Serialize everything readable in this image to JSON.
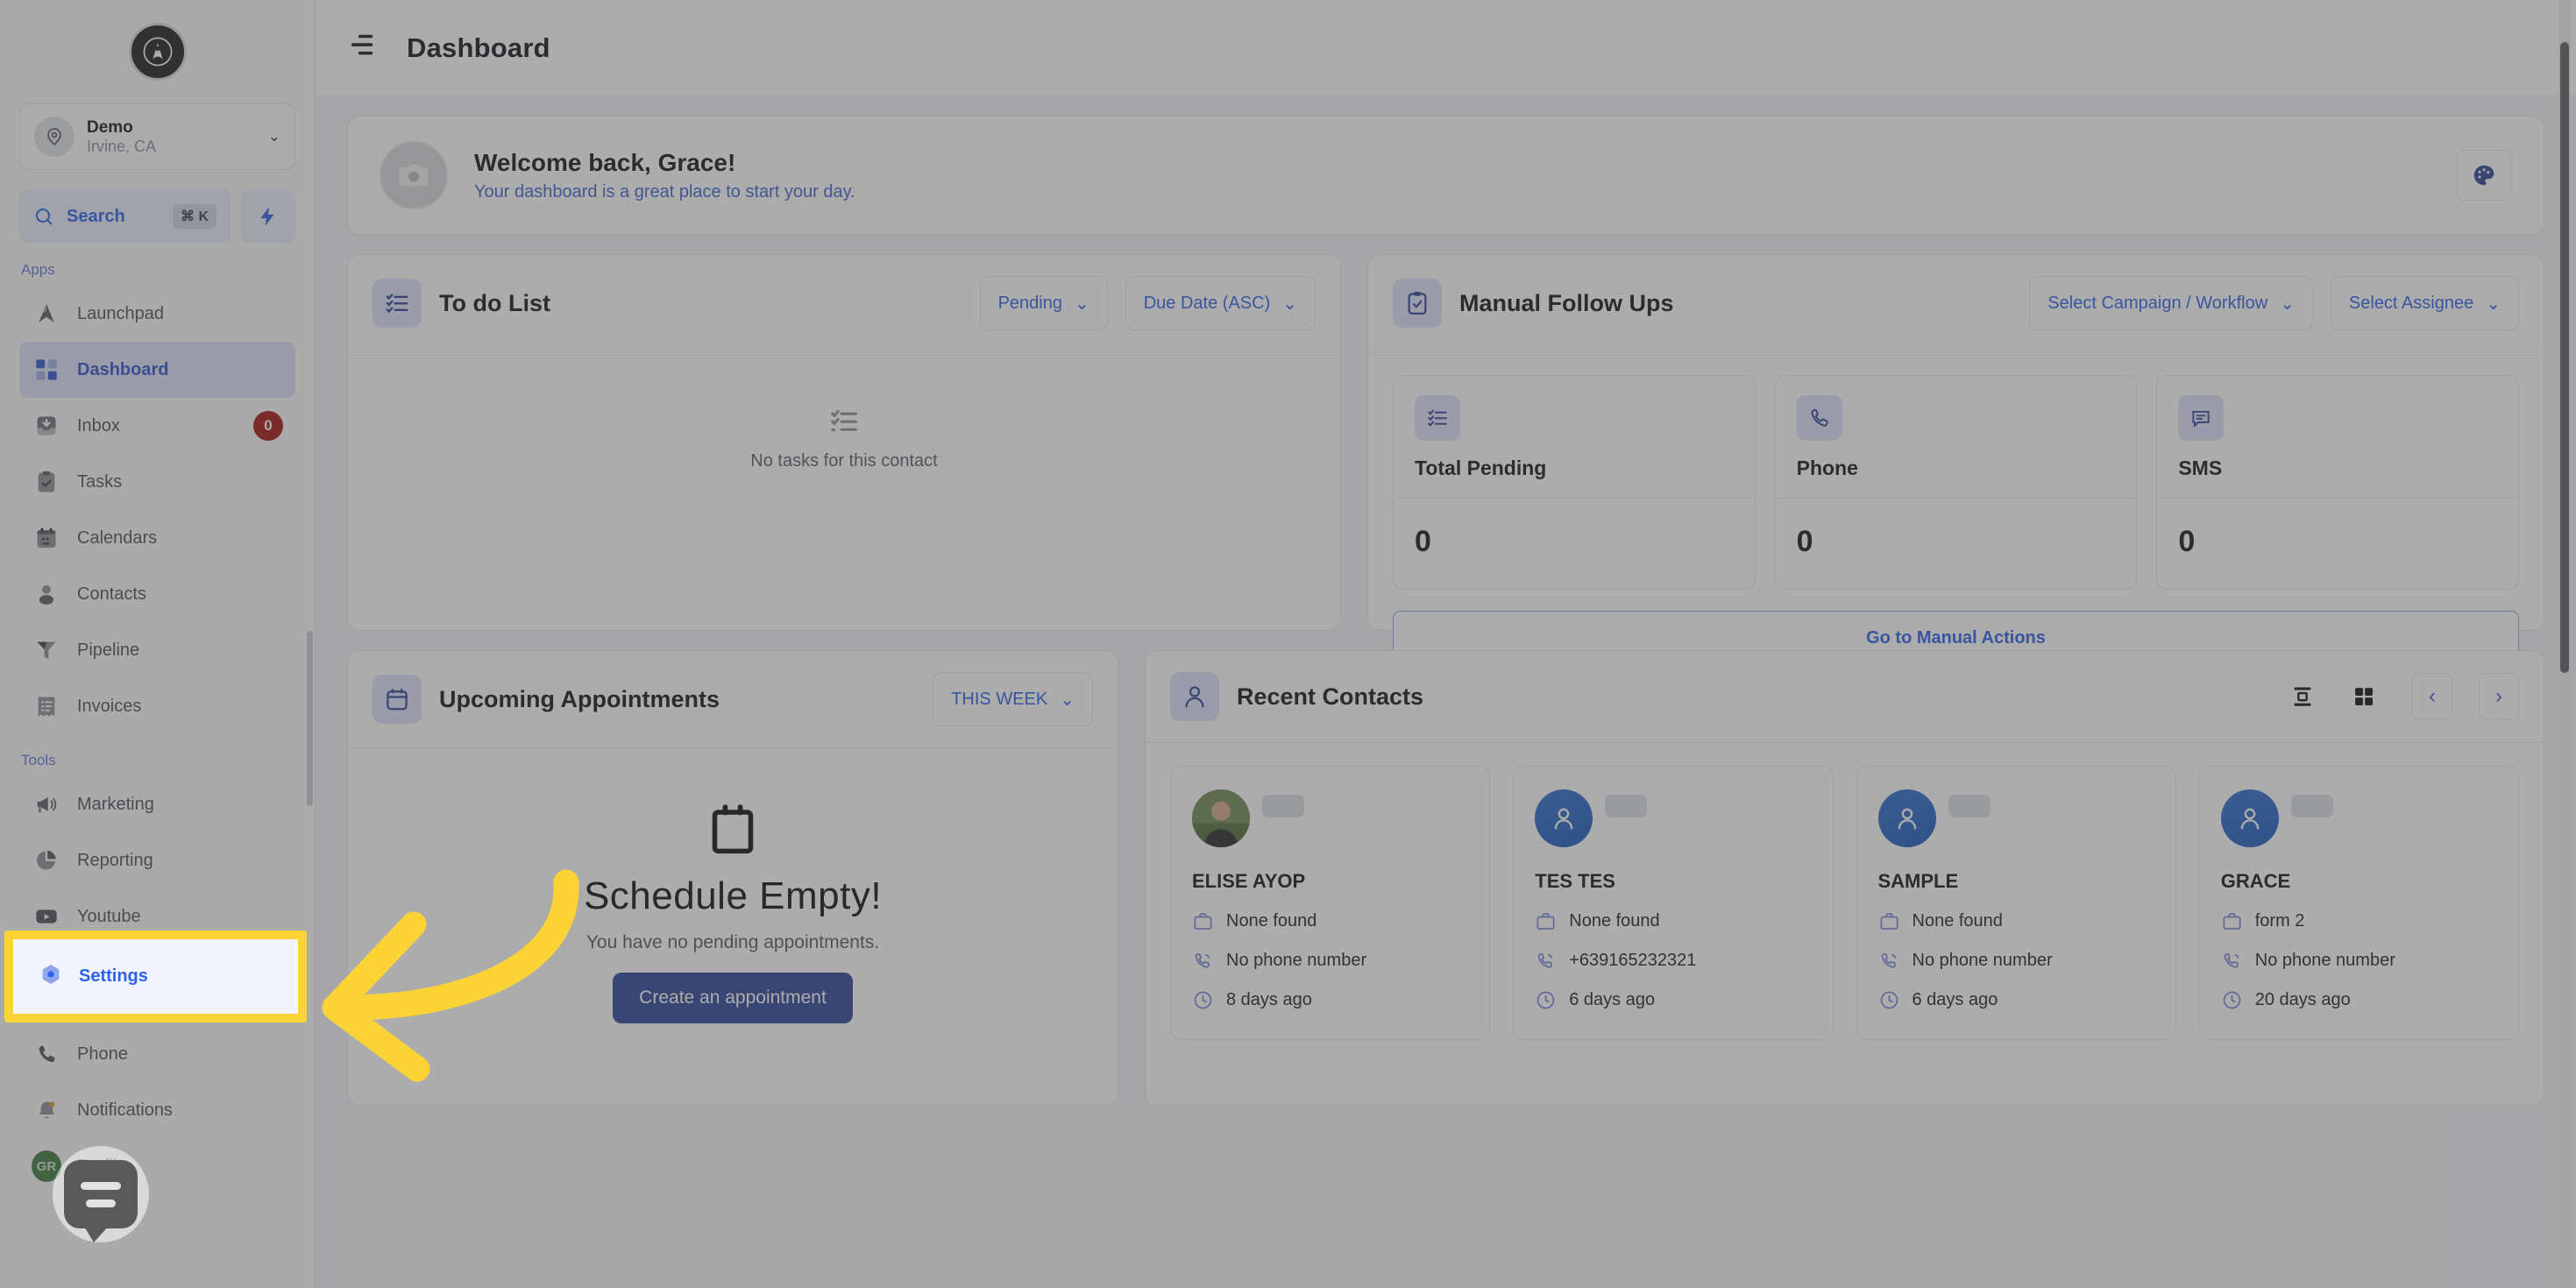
{
  "sidebar": {
    "logo_letter": "A",
    "location": {
      "name": "Demo",
      "sub": "Irvine, CA"
    },
    "search": {
      "label": "Search",
      "shortcut": "⌘ K"
    },
    "section_apps": "Apps",
    "section_tools": "Tools",
    "apps": [
      {
        "label": "Launchpad",
        "icon": "launchpad-icon",
        "active": false,
        "badge": ""
      },
      {
        "label": "Dashboard",
        "icon": "dashboard-icon",
        "active": true,
        "badge": ""
      },
      {
        "label": "Inbox",
        "icon": "inbox-icon",
        "active": false,
        "badge": "0"
      },
      {
        "label": "Tasks",
        "icon": "tasks-icon",
        "active": false,
        "badge": ""
      },
      {
        "label": "Calendars",
        "icon": "calendar-icon",
        "active": false,
        "badge": ""
      },
      {
        "label": "Contacts",
        "icon": "contacts-icon",
        "active": false,
        "badge": ""
      },
      {
        "label": "Pipeline",
        "icon": "pipeline-icon",
        "active": false,
        "badge": ""
      },
      {
        "label": "Invoices",
        "icon": "invoices-icon",
        "active": false,
        "badge": ""
      }
    ],
    "tools": [
      {
        "label": "Marketing",
        "icon": "megaphone-icon"
      },
      {
        "label": "Reporting",
        "icon": "pie-chart-icon"
      },
      {
        "label": "Youtube",
        "icon": "youtube-icon"
      },
      {
        "label": "Settings",
        "icon": "settings-icon"
      }
    ],
    "bottom": [
      {
        "label": "Phone",
        "icon": "phone-icon"
      },
      {
        "label": "Notifications",
        "icon": "bell-icon"
      },
      {
        "label": "Profile",
        "icon": "avatar-icon",
        "initials": "GR"
      }
    ]
  },
  "topbar": {
    "title": "Dashboard",
    "menu_icon": "hamburger-filter-icon"
  },
  "welcome": {
    "title": "Welcome back, Grace!",
    "subtitle": "Your dashboard is a great place to start your day.",
    "avatar_icon": "camera-icon",
    "palette_icon": "palette-icon"
  },
  "todo": {
    "title": "To do List",
    "icon": "checklist-icon",
    "filter_status": "Pending",
    "filter_sort": "Due Date (ASC)",
    "empty_text": "No tasks for this contact"
  },
  "followups": {
    "title": "Manual Follow Ups",
    "icon": "clipboard-check-icon",
    "filter_campaign": "Select Campaign / Workflow",
    "filter_assignee": "Select Assignee",
    "stats": [
      {
        "name": "Total Pending",
        "value": "0",
        "icon": "checklist-icon"
      },
      {
        "name": "Phone",
        "value": "0",
        "icon": "phone-icon"
      },
      {
        "name": "SMS",
        "value": "0",
        "icon": "sms-icon"
      }
    ],
    "cta": "Go to Manual Actions"
  },
  "appointments": {
    "title": "Upcoming Appointments",
    "icon": "calendar-icon",
    "range": "THIS WEEK",
    "empty_title": "Schedule Empty!",
    "empty_sub": "You have no pending appointments.",
    "cta": "Create an appointment"
  },
  "contacts_panel": {
    "title": "Recent Contacts",
    "icon": "user-icon",
    "view_list_icon": "list-view-icon",
    "view_grid_icon": "grid-view-icon",
    "prev_icon": "chevron-left-icon",
    "next_icon": "chevron-right-icon",
    "items": [
      {
        "name": "ELISE AYOP",
        "company": "None found",
        "phone": "No phone number",
        "time": "8 days ago",
        "avatar": "photo"
      },
      {
        "name": "TES TES",
        "company": "None found",
        "phone": "+639165232321",
        "time": "6 days ago",
        "avatar": "placeholder"
      },
      {
        "name": "SAMPLE",
        "company": "None found",
        "phone": "No phone number",
        "time": "6 days ago",
        "avatar": "placeholder"
      },
      {
        "name": "GRACE",
        "company": "form 2",
        "phone": "No phone number",
        "time": "20 days ago",
        "avatar": "placeholder"
      }
    ]
  },
  "annotation": {
    "highlight_label": "Settings",
    "highlight_color": "#fcd337",
    "arrow_color": "#fcd337"
  }
}
